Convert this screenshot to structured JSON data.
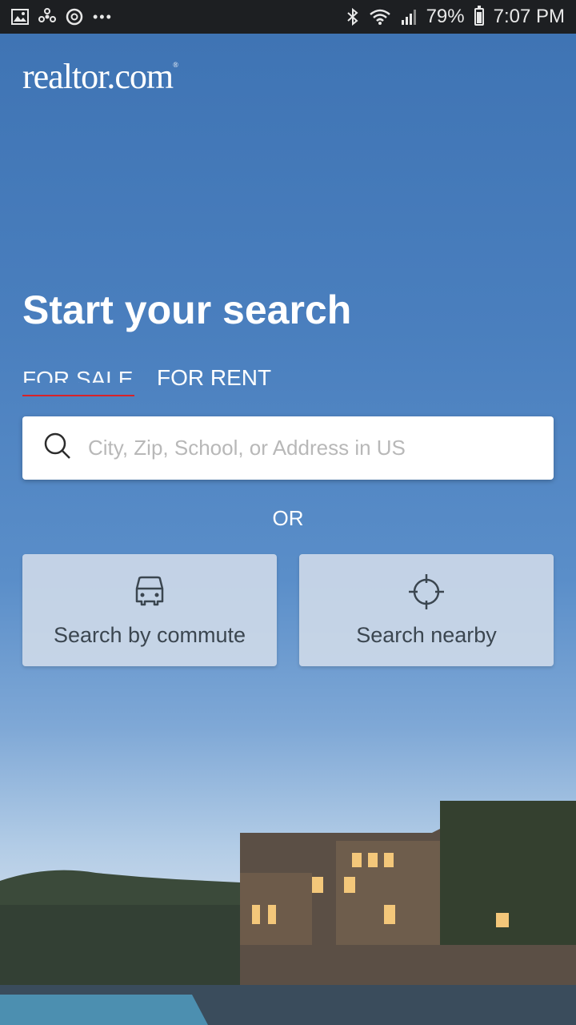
{
  "status_bar": {
    "battery": "79%",
    "time": "7:07 PM",
    "more": "•••",
    "left_icons": [
      "image-icon",
      "fan-icon",
      "sync-icon",
      "more-dots-icon"
    ],
    "right_icons": [
      "bluetooth-icon",
      "wifi-icon",
      "signal-icon",
      "battery-icon"
    ]
  },
  "app": {
    "logo": "realtor.com",
    "logo_mark": "®"
  },
  "main": {
    "headline": "Start your search",
    "tabs": [
      {
        "label": "FOR SALE",
        "active": true
      },
      {
        "label": "FOR RENT",
        "active": false
      }
    ],
    "search": {
      "placeholder": "City, Zip, School, or Address in US"
    },
    "or_label": "OR",
    "actions": [
      {
        "label": "Search by commute",
        "icon": "car-icon"
      },
      {
        "label": "Search nearby",
        "icon": "crosshair-icon"
      }
    ]
  },
  "colors": {
    "accent": "#d92228",
    "sky": "#3f76b6",
    "card_text": "#3b4650"
  }
}
